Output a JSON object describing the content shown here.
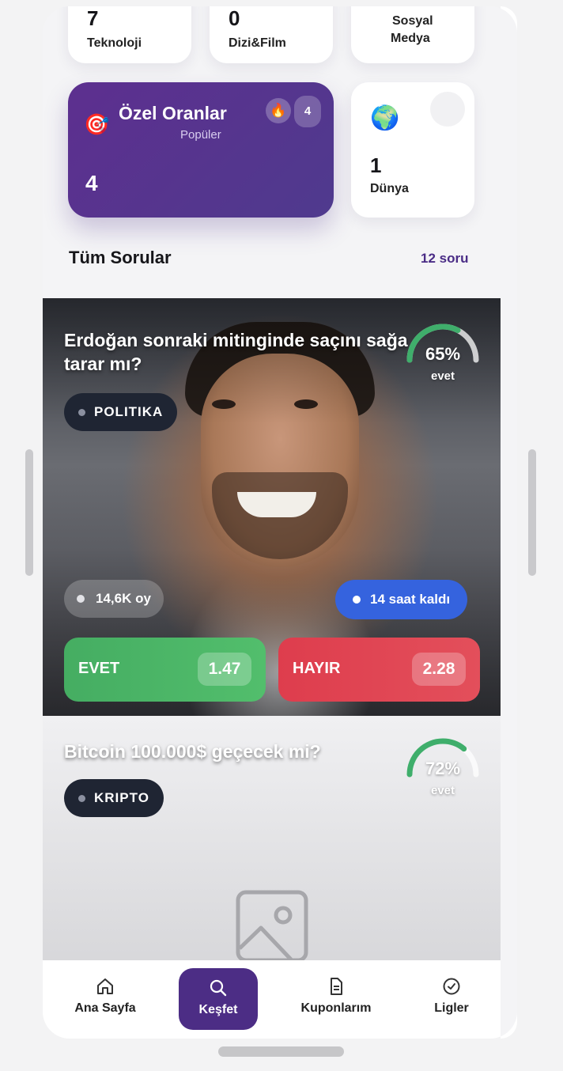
{
  "categories": [
    {
      "count": "7",
      "label": "Teknoloji"
    },
    {
      "count": "0",
      "label": "Dizi&Film"
    },
    {
      "count": "",
      "label_line1": "Sosyal",
      "label_line2": "Medya"
    }
  ],
  "special": {
    "icon": "dart-icon",
    "title": "Özel Oranlar",
    "subtitle": "Popüler",
    "count": "4",
    "fire": "🔥",
    "badge": "4"
  },
  "world": {
    "icon": "globe-icon",
    "count": "1",
    "label": "Dünya"
  },
  "section": {
    "title": "Tüm Sorular",
    "count": "12 soru"
  },
  "questions": [
    {
      "title": "Erdoğan sonraki mitinginde saçını sağa tarar mı?",
      "tag": "POLITIKA",
      "percent_text": "65%",
      "percent": 65,
      "percent_label": "evet",
      "votes": "14,6K oy",
      "time_left": "14 saat kaldı",
      "yes_label": "EVET",
      "yes_odds": "1.47",
      "no_label": "HAYIR",
      "no_odds": "2.28"
    },
    {
      "title": "Bitcoin 100.000$ geçecek mi?",
      "tag": "KRIPTO",
      "percent_text": "72%",
      "percent": 72,
      "percent_label": "evet"
    }
  ],
  "nav": [
    {
      "label": "Ana Sayfa",
      "icon": "home-icon"
    },
    {
      "label": "Keşfet",
      "icon": "search-icon",
      "active": true
    },
    {
      "label": "Kuponlarım",
      "icon": "document-icon"
    },
    {
      "label": "Ligler",
      "icon": "check-circle-icon"
    }
  ],
  "colors": {
    "accent": "#4c2d85",
    "yes": "#4cb566",
    "no": "#e0444f",
    "time": "#3563de",
    "gauge": "#3fae6b"
  }
}
